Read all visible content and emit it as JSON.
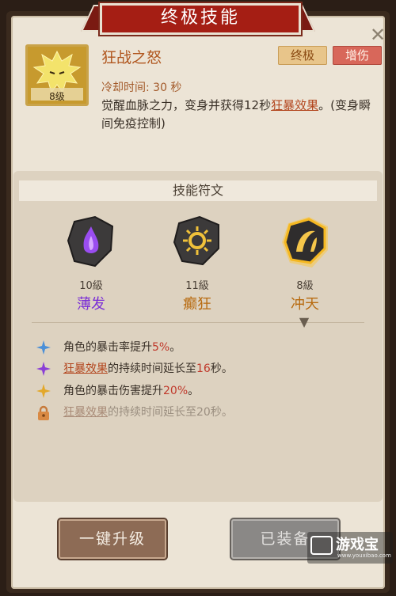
{
  "header": {
    "title": "终极技能",
    "close_symbol": "✕"
  },
  "skill": {
    "name": "狂战之怒",
    "level": "8级",
    "tags": [
      "终极",
      "增伤"
    ],
    "cooldown": "冷却时间: 30 秒",
    "desc_part1": "觉醒血脉之力，变身并获得12秒",
    "desc_link": "狂暴效果",
    "desc_part2": "。(变身瞬间免疫控制)"
  },
  "runes": {
    "title": "技能符文",
    "items": [
      {
        "level": "10級",
        "name": "薄发",
        "color": "#7b2fd6"
      },
      {
        "level": "11級",
        "name": "癫狂",
        "color": "#b86b10"
      },
      {
        "level": "8級",
        "name": "冲天",
        "color": "#b86b10"
      }
    ]
  },
  "effects": [
    {
      "icon": "blue-star-icon",
      "pre": "角色的暴击率提升",
      "value": "5%",
      "post": "。"
    },
    {
      "icon": "purple-star-icon",
      "link": "狂暴效果",
      "pre": "的持续时间延长至",
      "value": "16",
      "post": "秒。"
    },
    {
      "icon": "gold-star-icon",
      "pre": "角色的暴击伤害提升",
      "value": "20%",
      "post": "。"
    },
    {
      "icon": "lock-icon",
      "link": "狂暴效果",
      "pre": "的持续时间延长至",
      "value": "20",
      "post": "秒。"
    }
  ],
  "buttons": {
    "upgrade": "一键升级",
    "equipped": "已装备"
  },
  "watermark": {
    "name": "游戏宝",
    "url": "www.youxibao.com"
  }
}
